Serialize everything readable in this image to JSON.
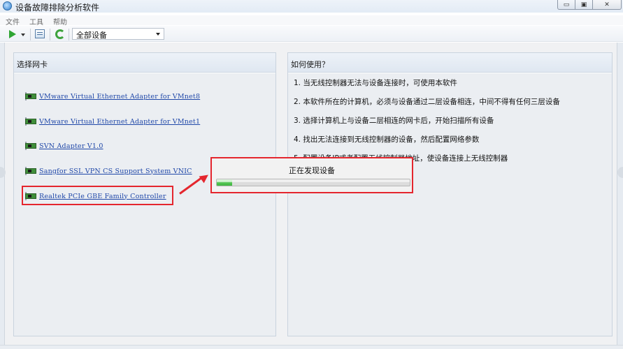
{
  "window": {
    "title": "设备故障排除分析软件"
  },
  "menu": [
    "文件",
    "工具",
    "帮助"
  ],
  "toolbar": {
    "play_icon": "play-icon",
    "list_icon": "device-list-icon",
    "refresh_icon": "refresh-icon",
    "device_filter": {
      "selected": "全部设备"
    }
  },
  "left_panel": {
    "title": "选择网卡",
    "adapters": [
      "VMware Virtual Ethernet Adapter for VMnet8",
      "VMware Virtual Ethernet Adapter for VMnet1",
      "SVN Adapter V1.0",
      "Sangfor SSL VPN CS Support System VNIC",
      "Realtek PCIe GBE Family Controller"
    ],
    "selected_index": 4
  },
  "right_panel": {
    "title": "如何使用？",
    "steps": [
      "1. 当无线控制器无法与设备连接时，可使用本软件",
      "2. 本软件所在的计算机，必须与设备通过二层设备相连，中间不得有任何三层设备",
      "3. 选择计算机上与设备二层相连的网卡后，开始扫描所有设备",
      "4. 找出无法连接到无线控制器的设备，然后配置网络参数",
      "5. 配置设备IP或者配置无线控制器地址，使设备连接上无线控制器"
    ]
  },
  "progress_dialog": {
    "message": "正在发现设备",
    "progress": 0.08
  },
  "colors": {
    "annotation_red": "#e4262e",
    "link_blue": "#1f47a8",
    "progress_green": "#54c654"
  }
}
